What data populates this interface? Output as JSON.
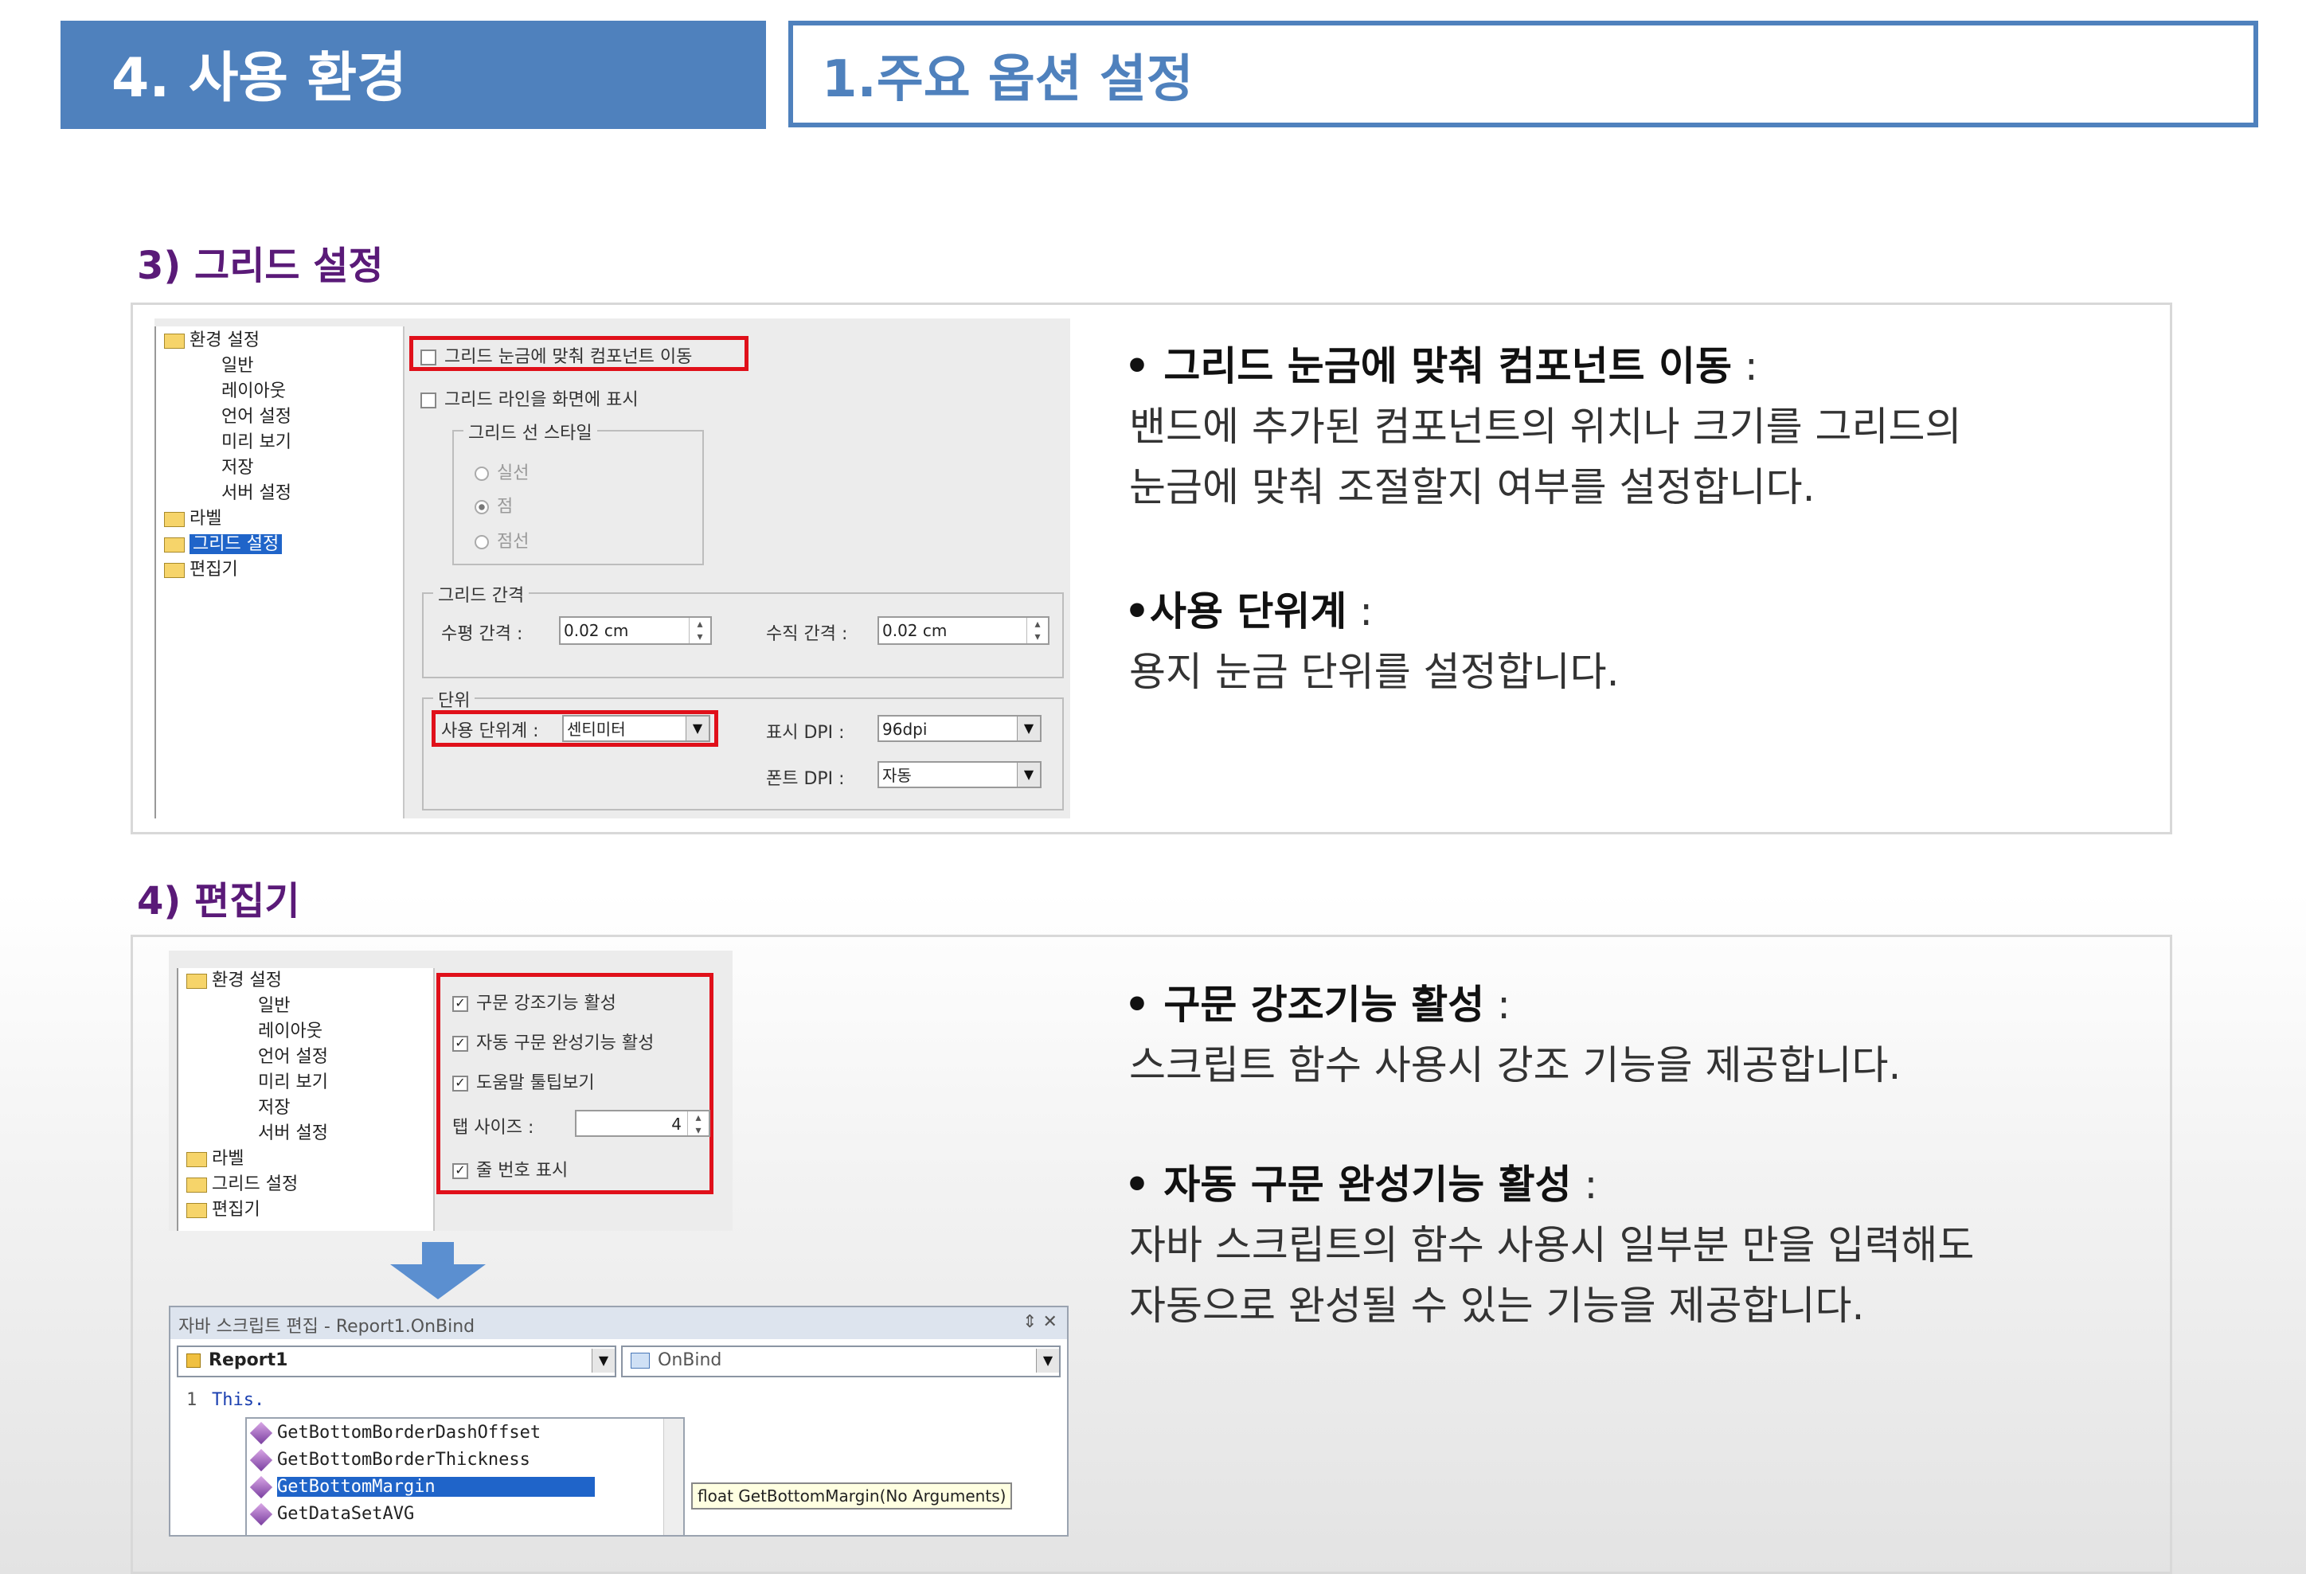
{
  "header": {
    "section": "4. 사용 환경",
    "subtitle": "1.주요 옵션 설정"
  },
  "grid_section": {
    "title": "3) 그리드 설정",
    "tree": [
      "환경 설정",
      "일반",
      "레이아웃",
      "언어 설정",
      "미리 보기",
      "저장",
      "서버 설정",
      "라벨",
      "그리드 설정",
      "편집기"
    ],
    "opt_snap": "그리드 눈금에 맞춰 컴포넌트 이동",
    "opt_show_lines": "그리드 라인을 화면에 표시",
    "line_style_label": "그리드 선 스타일",
    "line_styles": [
      "실선",
      "점",
      "점선"
    ],
    "spacing_label": "그리드 간격",
    "h_spacing_label": "수평 간격 :",
    "h_spacing_value": "0.02 cm",
    "v_spacing_label": "수직 간격 :",
    "v_spacing_value": "0.02 cm",
    "unit_label": "단위",
    "unit_field_label": "사용 단위계 :",
    "unit_value": "센티미터",
    "display_dpi_label": "표시 DPI :",
    "display_dpi_value": "96dpi",
    "font_dpi_label": "폰트 DPI :",
    "font_dpi_value": "자동",
    "desc1_title": "그리드 눈금에 맞춰 컴포넌트 이동",
    "desc1_line1": "밴드에 추가된 컴포넌트의 위치나 크기를 그리드의",
    "desc1_line2": "눈금에 맞춰 조절할지 여부를 설정합니다.",
    "desc2_title": "사용 단위계",
    "desc2_line1": "용지 눈금 단위를 설정합니다."
  },
  "editor_section": {
    "title": "4) 편집기",
    "tree": [
      "환경 설정",
      "일반",
      "레이아웃",
      "언어 설정",
      "미리 보기",
      "저장",
      "서버 설정",
      "라벨",
      "그리드 설정",
      "편집기"
    ],
    "opt_syntax": "구문 강조기능 활성",
    "opt_autocomplete": "자동 구문 완성기능 활성",
    "opt_tooltip": "도움말 툴팁보기",
    "tab_size_label": "탭 사이즈 :",
    "tab_size_value": "4",
    "opt_line_numbers": "줄 번호 표시",
    "script_title": "자바 스크립트 편집 - Report1.OnBind",
    "script_close": "⇕ ✕",
    "combo_object": "Report1",
    "combo_event": "OnBind",
    "code_line_no": "1",
    "code_text": "This.",
    "autocomplete": [
      "GetBottomBorderDashOffset",
      "GetBottomBorderThickness",
      "GetBottomMargin",
      "GetDataSetAVG"
    ],
    "tooltip": "float GetBottomMargin(No Arguments)",
    "desc1_title": "구문 강조기능 활성",
    "desc1_line1": "스크립트 함수 사용시 강조 기능을 제공합니다.",
    "desc2_title": "자동 구문 완성기능 활성",
    "desc2_line1": "자바 스크립트의 함수 사용시 일부분 만을 입력해도",
    "desc2_line2": "자동으로 완성될 수 있는 기능을 제공합니다."
  },
  "colors": {
    "header_blue": "#4f81bd",
    "section_purple": "#5a1a78",
    "highlight_red": "#e0101a"
  }
}
